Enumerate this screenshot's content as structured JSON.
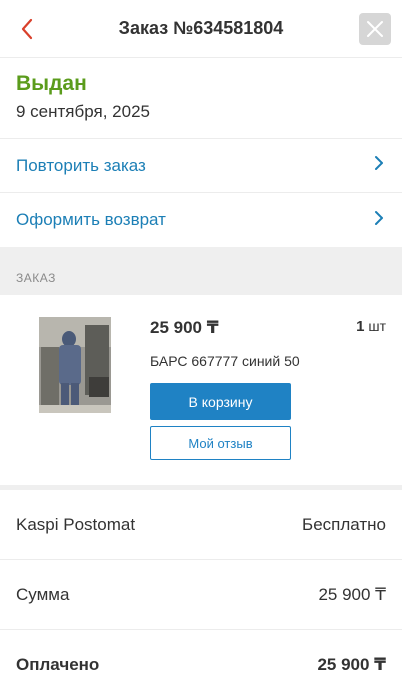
{
  "header": {
    "title": "Заказ №634581804",
    "back_icon": "chevron-left-icon",
    "close_icon": "close-icon",
    "accent_color": "#d9402b"
  },
  "status": {
    "label": "Выдан",
    "date": "9 сентября, 2025",
    "color": "#5b9c1c"
  },
  "actions": [
    {
      "label": "Повторить заказ",
      "icon": "chevron-right-icon"
    },
    {
      "label": "Оформить возврат",
      "icon": "chevron-right-icon"
    }
  ],
  "order_section": {
    "heading": "ЗАКАЗ"
  },
  "product": {
    "price": "25 900 ₸",
    "qty_number": "1",
    "qty_unit": " шт",
    "name": "БАРС 667777 синий 50",
    "cart_button": "В корзину",
    "review_button": "Мой отзыв",
    "link_color": "#1f82c4"
  },
  "summary": [
    {
      "label": "Kaspi Postomat",
      "value": "Бесплатно"
    },
    {
      "label": "Сумма",
      "value": "25 900 ₸"
    },
    {
      "label": "Оплачено",
      "value": "25 900 ₸"
    }
  ]
}
